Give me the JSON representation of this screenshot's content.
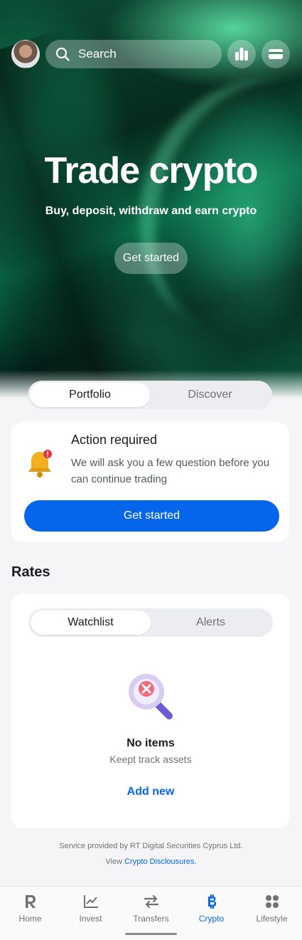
{
  "header": {
    "search_placeholder": "Search",
    "avatar_icon": "user-avatar",
    "stats_icon": "bar-chart-icon",
    "card_icon": "credit-card-icon"
  },
  "hero": {
    "title": "Trade crypto",
    "subtitle": "Buy, deposit, withdraw and earn crypto",
    "button_label": "Get started",
    "accent_color": "#1fbf85"
  },
  "main_tabs": [
    {
      "label": "Portfolio",
      "active": true
    },
    {
      "label": "Discover",
      "active": false
    }
  ],
  "action_card": {
    "title": "Action required",
    "text": "We will ask you a few question before you can continue trading",
    "button_label": "Get started",
    "icon": "bell-alert-icon",
    "button_color": "#0666eb"
  },
  "rates": {
    "title": "Rates",
    "tabs": [
      {
        "label": "Watchlist",
        "active": true
      },
      {
        "label": "Alerts",
        "active": false
      }
    ],
    "empty_icon": "magnifier-empty-icon",
    "empty_title": "No items",
    "empty_subtitle": "Keept track assets",
    "add_label": "Add new"
  },
  "footer": {
    "service_text": "Service provided by RT Digital Securities Cyprus Ltd.",
    "view_text": "View",
    "link_text": "Crypto Disclousures."
  },
  "nav": {
    "items": [
      {
        "label": "Home",
        "icon": "revolut-logo-icon",
        "active": false
      },
      {
        "label": "Invest",
        "icon": "chart-line-icon",
        "active": false
      },
      {
        "label": "Transfers",
        "icon": "transfer-arrows-icon",
        "active": false
      },
      {
        "label": "Crypto",
        "icon": "bitcoin-icon",
        "active": true
      },
      {
        "label": "Lifestyle",
        "icon": "grid-icon",
        "active": false
      }
    ],
    "active_color": "#0666eb"
  }
}
